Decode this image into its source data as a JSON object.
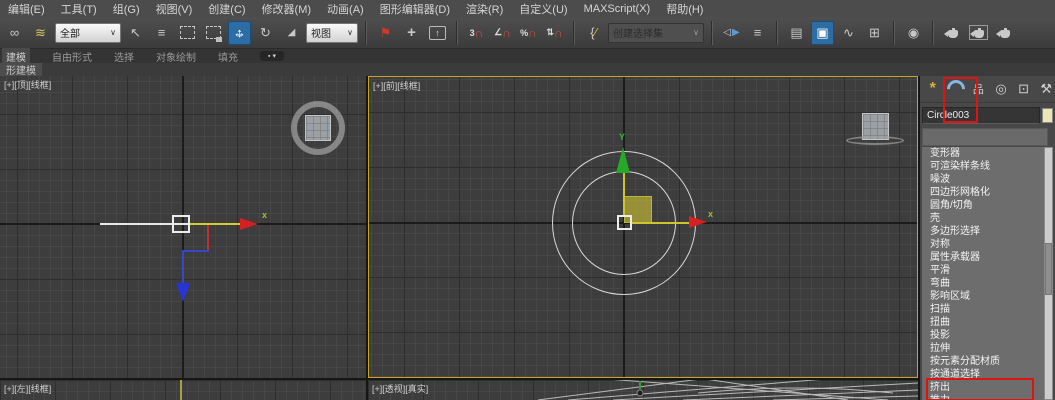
{
  "menu": [
    "编辑(E)",
    "工具(T)",
    "组(G)",
    "视图(V)",
    "创建(C)",
    "修改器(M)",
    "动画(A)",
    "图形编辑器(D)",
    "渲染(R)",
    "自定义(U)",
    "MAXScript(X)",
    "帮助(H)"
  ],
  "toolbar": {
    "selection_filter": "全部",
    "coordinate_system": "视图",
    "selection_set_placeholder": "创建选择集",
    "glyphs": {
      "link": "∞",
      "space_warp": "≋",
      "select_cursor": "↖",
      "select_by_name": "≡",
      "rotate": "↻",
      "scale_corner": "◢",
      "manipulate": "⚑",
      "place": "+",
      "key_arrow": "↑",
      "snap_three": "3",
      "magnet": "∩",
      "angle": "∠",
      "percent": "%",
      "spinner": "⇅",
      "brace": "{",
      "pencil": "∕",
      "mirror_left": "◁",
      "mirror_right": "▶",
      "align": "≡",
      "layers": "▤",
      "explorer": "▣",
      "curve": "∿",
      "schematic": "⊞",
      "material": "◉",
      "combo_arrow": "∨",
      "caret": "▾"
    }
  },
  "ribbon": {
    "tabs": [
      "建模",
      "自由形式",
      "选择",
      "对象绘制",
      "填充"
    ],
    "active_tab": "建模",
    "panel_label": "形建模"
  },
  "viewports": {
    "top": {
      "label": "[+][顶][线框]",
      "x_axis": "x"
    },
    "front": {
      "label": "[+][前][线框]",
      "x_axis": "x",
      "y_axis": "Y"
    },
    "left": {
      "label": "[+][左][线框]"
    },
    "perspective": {
      "label": "[+][透视][真实]"
    }
  },
  "command_panel": {
    "tab_glyphs": {
      "create": "*",
      "hierarchy": "品",
      "motion": "◎",
      "display": "⊡",
      "utilities": "⚒"
    },
    "object_name": "Circle003",
    "modifiers": [
      "变形器",
      "可渲染样条线",
      "噪波",
      "四边形网格化",
      "圆角/切角",
      "壳",
      "多边形选择",
      "对称",
      "属性承载器",
      "平滑",
      "弯曲",
      "影响区域",
      "扫描",
      "扭曲",
      "投影",
      "拉伸",
      "按元素分配材质",
      "按通道选择",
      "挤出",
      "推力"
    ],
    "highlighted_modifier": "挤出"
  },
  "colors": {
    "annotation_red": "#e01212",
    "active_viewport_border": "#c9a227",
    "selection_yellow": "#d5ca34",
    "axis_red": "#d42020",
    "axis_green": "#2aa82a",
    "axis_blue": "#2f3bd0"
  }
}
